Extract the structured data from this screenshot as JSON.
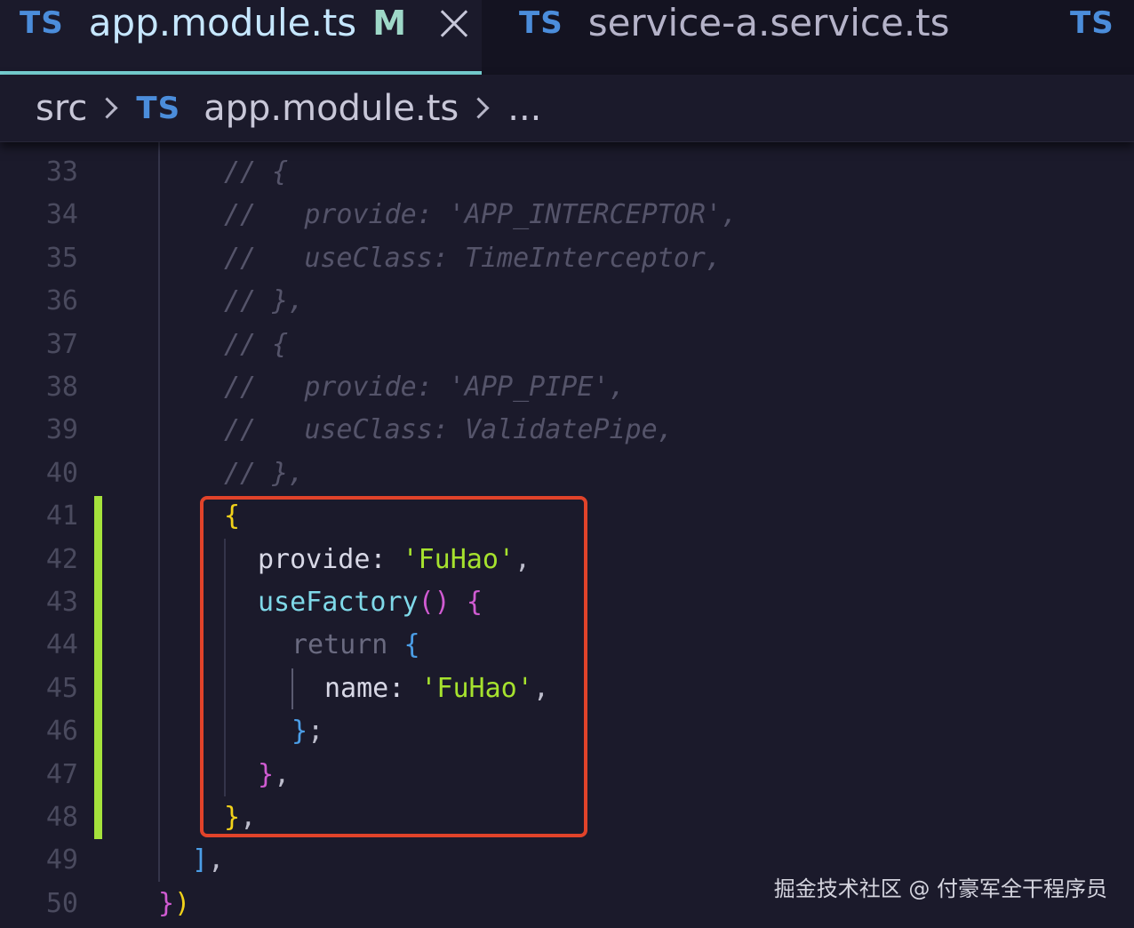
{
  "tabs": [
    {
      "icon": "TS",
      "label": "app.module.ts",
      "modified": "M",
      "active": true
    },
    {
      "icon": "TS",
      "label": "service-a.service.ts",
      "active": false
    },
    {
      "icon": "TS",
      "label": "",
      "active": false
    }
  ],
  "breadcrumb": {
    "folder": "src",
    "file_icon": "TS",
    "file": "app.module.ts",
    "more": "..."
  },
  "editor": {
    "lines": [
      {
        "n": "33"
      },
      {
        "n": "34"
      },
      {
        "n": "35"
      },
      {
        "n": "36"
      },
      {
        "n": "37"
      },
      {
        "n": "38"
      },
      {
        "n": "39"
      },
      {
        "n": "40"
      },
      {
        "n": "41"
      },
      {
        "n": "42"
      },
      {
        "n": "43"
      },
      {
        "n": "44"
      },
      {
        "n": "45"
      },
      {
        "n": "46"
      },
      {
        "n": "47"
      },
      {
        "n": "48"
      },
      {
        "n": "49"
      },
      {
        "n": "50"
      }
    ],
    "code": {
      "l33": "// {",
      "l34a": "//   ",
      "l34b": "provide: ",
      "l34c": "'APP_INTERCEPTOR',",
      "l35a": "//   ",
      "l35b": "useClass: ",
      "l35c": "TimeInterceptor,",
      "l36": "// },",
      "l37": "// {",
      "l38a": "//   ",
      "l38b": "provide: ",
      "l38c": "'APP_PIPE',",
      "l39a": "//   ",
      "l39b": "useClass: ",
      "l39c": "ValidatePipe,",
      "l40": "// },",
      "l41": "{",
      "l42_key": "provide: ",
      "l42_val": "'FuHao'",
      "l42_end": ",",
      "l43_fn": "useFactory",
      "l43_par": "()",
      "l43_sp": " ",
      "l43_br": "{",
      "l44_kw": "return ",
      "l44_br": "{",
      "l45_key": "name: ",
      "l45_val": "'FuHao'",
      "l45_end": ",",
      "l46_br": "}",
      "l46_end": ";",
      "l47_br": "}",
      "l47_end": ",",
      "l48_br": "}",
      "l48_end": ",",
      "l49_br": "]",
      "l49_end": ",",
      "l50_br1": "}",
      "l50_br2": ")"
    }
  },
  "watermark": "掘金技术社区 @ 付豪军全干程序员",
  "colors": {
    "background": "#1b1a2b",
    "tab_underline": "#76d0d2",
    "ts_icon": "#4b8ddb",
    "string": "#a6e22e",
    "function": "#7fd9e9",
    "highlight_box": "#e1432a",
    "gutter_modified": "#a5e23c"
  }
}
